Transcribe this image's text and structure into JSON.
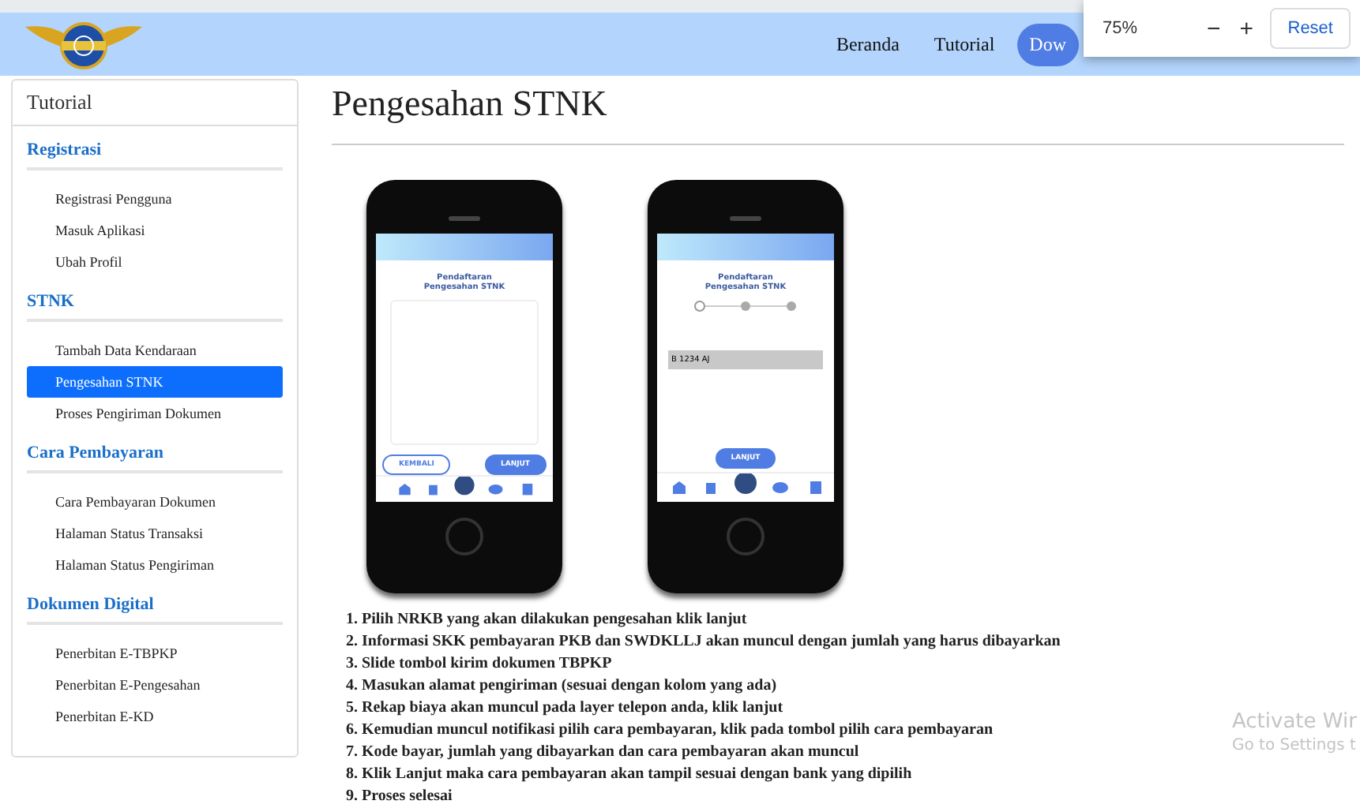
{
  "header": {
    "nav": [
      {
        "label": "Beranda",
        "kind": "link"
      },
      {
        "label": "Tutorial",
        "kind": "link"
      },
      {
        "label": "Dow",
        "kind": "button"
      }
    ]
  },
  "zoom_popup": {
    "level": "75%",
    "minus": "−",
    "plus": "+",
    "reset": "Reset"
  },
  "sidebar": {
    "title": "Tutorial",
    "sections": [
      {
        "heading": "Registrasi",
        "items": [
          {
            "label": "Registrasi Pengguna",
            "selected": false
          },
          {
            "label": "Masuk Aplikasi",
            "selected": false
          },
          {
            "label": "Ubah Profil",
            "selected": false
          }
        ]
      },
      {
        "heading": "STNK",
        "items": [
          {
            "label": "Tambah Data Kendaraan",
            "selected": false
          },
          {
            "label": "Pengesahan STNK",
            "selected": true
          },
          {
            "label": "Proses Pengiriman Dokumen",
            "selected": false
          }
        ]
      },
      {
        "heading": "Cara Pembayaran",
        "items": [
          {
            "label": "Cara Pembayaran Dokumen",
            "selected": false
          },
          {
            "label": "Halaman Status Transaksi",
            "selected": false
          },
          {
            "label": "Halaman Status Pengiriman",
            "selected": false
          }
        ]
      },
      {
        "heading": "Dokumen Digital",
        "items": [
          {
            "label": "Penerbitan E-TBPKP",
            "selected": false
          },
          {
            "label": "Penerbitan E-Pengesahan",
            "selected": false
          },
          {
            "label": "Penerbitan E-KD",
            "selected": false
          }
        ]
      }
    ]
  },
  "page": {
    "title": "Pengesahan STNK",
    "phones": [
      {
        "kind": "form",
        "heading": "Pendaftaran Pengesahan STNK",
        "buttons": [
          "KEMBALI",
          "LANJUT"
        ]
      },
      {
        "kind": "select",
        "heading": "Pendaftaran Pengesahan STNK",
        "value": "B 1234 AJ",
        "buttons": [
          "LANJUT"
        ]
      }
    ],
    "steps": [
      "1. Pilih NRKB yang akan dilakukan pengesahan klik lanjut",
      "2. Informasi SKK pembayaran PKB dan SWDKLLJ akan muncul dengan jumlah yang harus dibayarkan",
      "3. Slide tombol kirim dokumen TBPKP",
      "4. Masukan alamat pengiriman (sesuai dengan kolom yang ada)",
      "5. Rekap biaya akan muncul pada layer telepon anda, klik lanjut",
      "6. Kemudian muncul notifikasi pilih cara pembayaran, klik pada tombol pilih cara pembayaran",
      "7. Kode bayar, jumlah yang dibayarkan dan cara pembayaran akan muncul",
      "8. Klik Lanjut maka cara pembayaran akan tampil sesuai dengan bank yang dipilih",
      "9. Proses selesai"
    ]
  },
  "os_notice": {
    "title": "Activate Wir",
    "subtitle": "Go to Settings t"
  }
}
